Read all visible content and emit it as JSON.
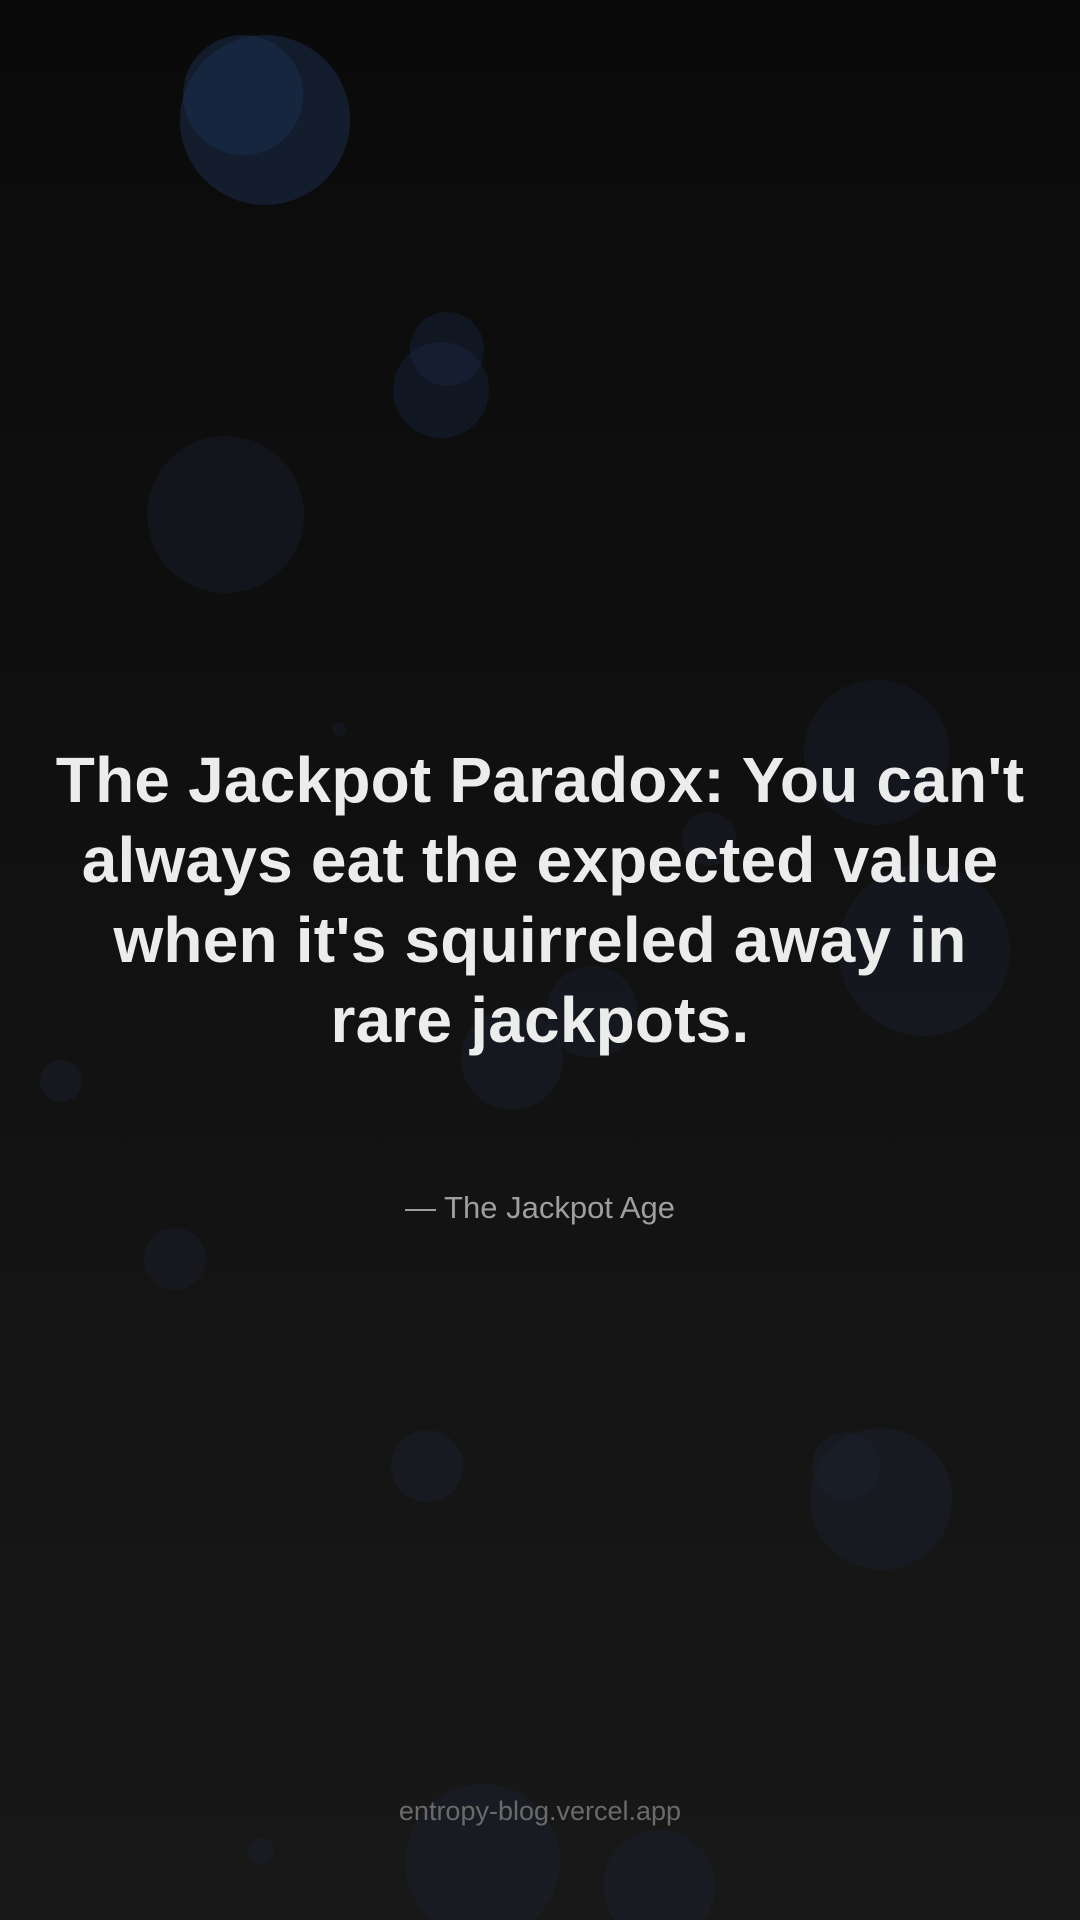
{
  "quote": {
    "text": "The Jackpot Paradox: You can't always eat the expected value when it's squirreled away in rare jackpots.",
    "attribution": "— The Jackpot Age"
  },
  "footer": {
    "url": "entropy-blog.vercel.app"
  },
  "colors": {
    "background": "#0b0b0b",
    "quote_text": "#ececec",
    "attribution_text": "#9e9e9e",
    "footer_text": "#6a6a6a",
    "bubble": "#1a2c4a"
  }
}
